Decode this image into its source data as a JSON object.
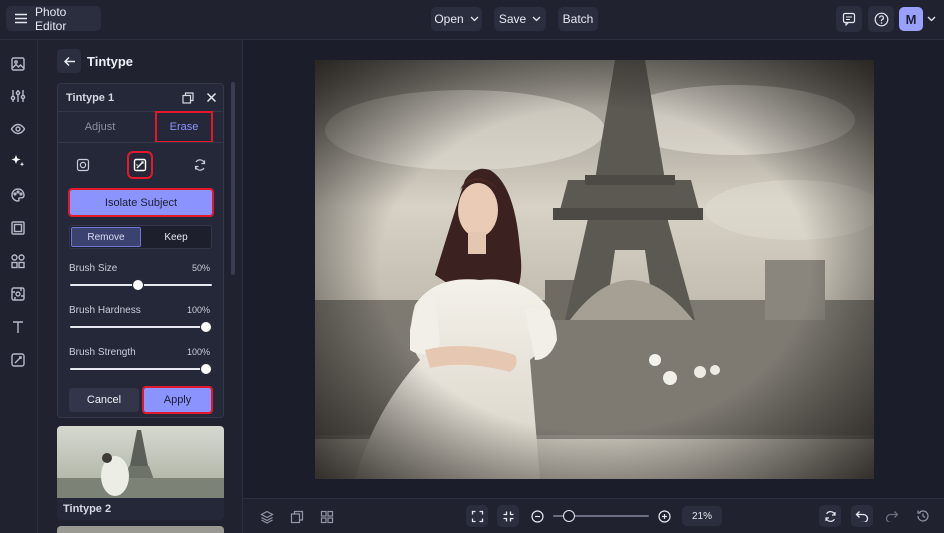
{
  "header": {
    "app_title": "Photo Editor",
    "open_label": "Open",
    "save_label": "Save",
    "batch_label": "Batch",
    "avatar_initial": "M"
  },
  "panel": {
    "title": "Tintype",
    "card_title": "Tintype 1",
    "tabs": [
      "Adjust",
      "Erase"
    ],
    "active_tab": "Erase",
    "isolate_label": "Isolate Subject",
    "mode_options": [
      "Remove",
      "Keep"
    ],
    "active_mode": "Remove",
    "sliders": [
      {
        "label": "Brush Size",
        "value_text": "50%",
        "value": 0.5
      },
      {
        "label": "Brush Hardness",
        "value_text": "100%",
        "value": 1.0
      },
      {
        "label": "Brush Strength",
        "value_text": "100%",
        "value": 1.0
      }
    ],
    "cancel_label": "Cancel",
    "apply_label": "Apply",
    "next_preset_label": "Tintype 2"
  },
  "bottom": {
    "zoom_text": "21%",
    "zoom_value": 0.21
  },
  "colors": {
    "accent": "#8b93ff",
    "highlight": "#e3182c",
    "avatar": "#9aa0ff"
  }
}
